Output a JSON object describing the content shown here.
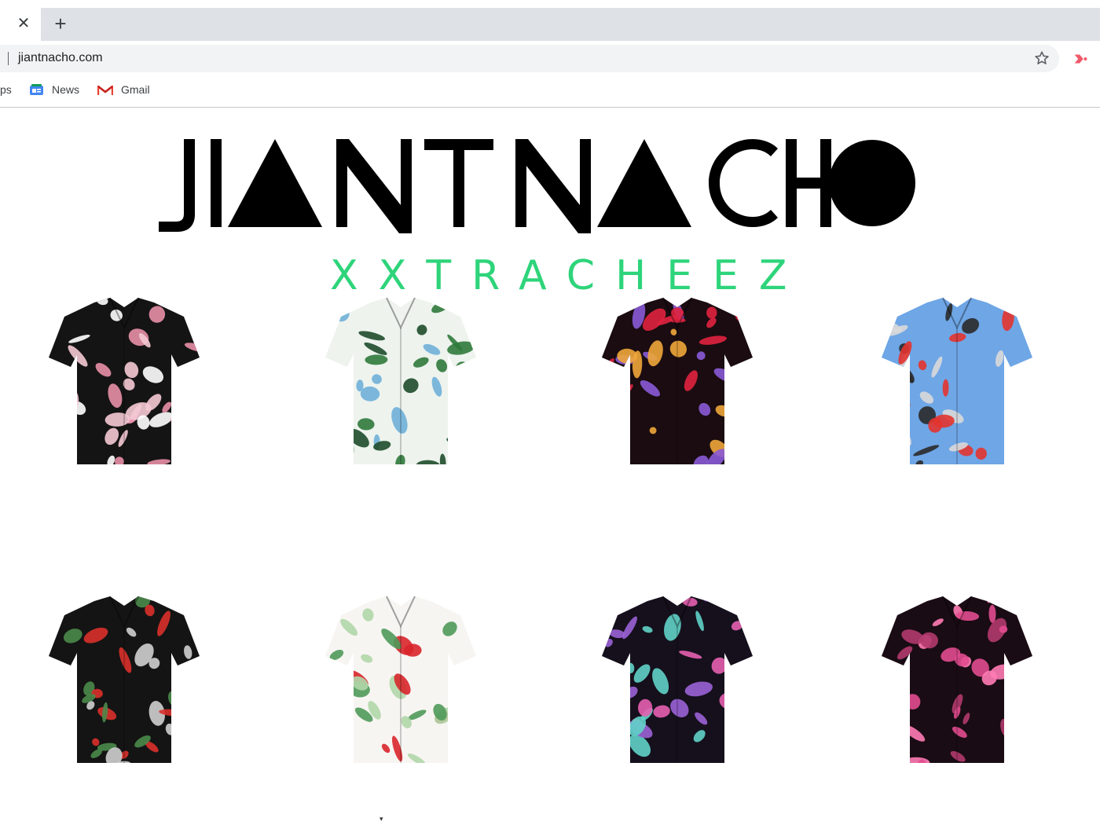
{
  "browser": {
    "url": "jiantnacho.com",
    "bookmarks": [
      {
        "label": "ps",
        "icon": "apps-icon"
      },
      {
        "label": "News",
        "icon": "news-icon"
      },
      {
        "label": "Gmail",
        "icon": "gmail-icon"
      }
    ],
    "tab_close_glyph": "✕",
    "new_tab_glyph": "+"
  },
  "site": {
    "logo_text": "JIANT NACHO",
    "tagline": "XXTRACHEEZ",
    "accent_color": "#2ed47a"
  },
  "products": [
    {
      "name": "shirt-black-pink-feather",
      "base": "#141414",
      "print": [
        "#f4c9d4",
        "#e88fa6",
        "#ffffff"
      ]
    },
    {
      "name": "shirt-white-palm",
      "base": "#eef3ee",
      "print": [
        "#2f7a3b",
        "#6fb0d8",
        "#1e4d2a"
      ]
    },
    {
      "name": "shirt-black-red-floral",
      "base": "#1a0c10",
      "print": [
        "#e0223f",
        "#8a5ad6",
        "#f0a63a"
      ]
    },
    {
      "name": "shirt-blue-cars-poppies",
      "base": "#6ea6e6",
      "print": [
        "#e3342d",
        "#d9d9d9",
        "#2a2a2a"
      ]
    },
    {
      "name": "shirt-black-cars-poppies",
      "base": "#141414",
      "print": [
        "#d9302a",
        "#cfcfcf",
        "#4a8a4a"
      ]
    },
    {
      "name": "shirt-white-poppies",
      "base": "#f7f5f2",
      "print": [
        "#d8262b",
        "#4f9a5a",
        "#b0d7a8"
      ]
    },
    {
      "name": "shirt-black-purple-leaf",
      "base": "#15101c",
      "print": [
        "#9a62d6",
        "#e65fb0",
        "#5fd1c8"
      ]
    },
    {
      "name": "shirt-black-pink-leaf",
      "base": "#1a0c14",
      "print": [
        "#e24b8f",
        "#ff7bb4",
        "#b13a6d"
      ]
    }
  ]
}
